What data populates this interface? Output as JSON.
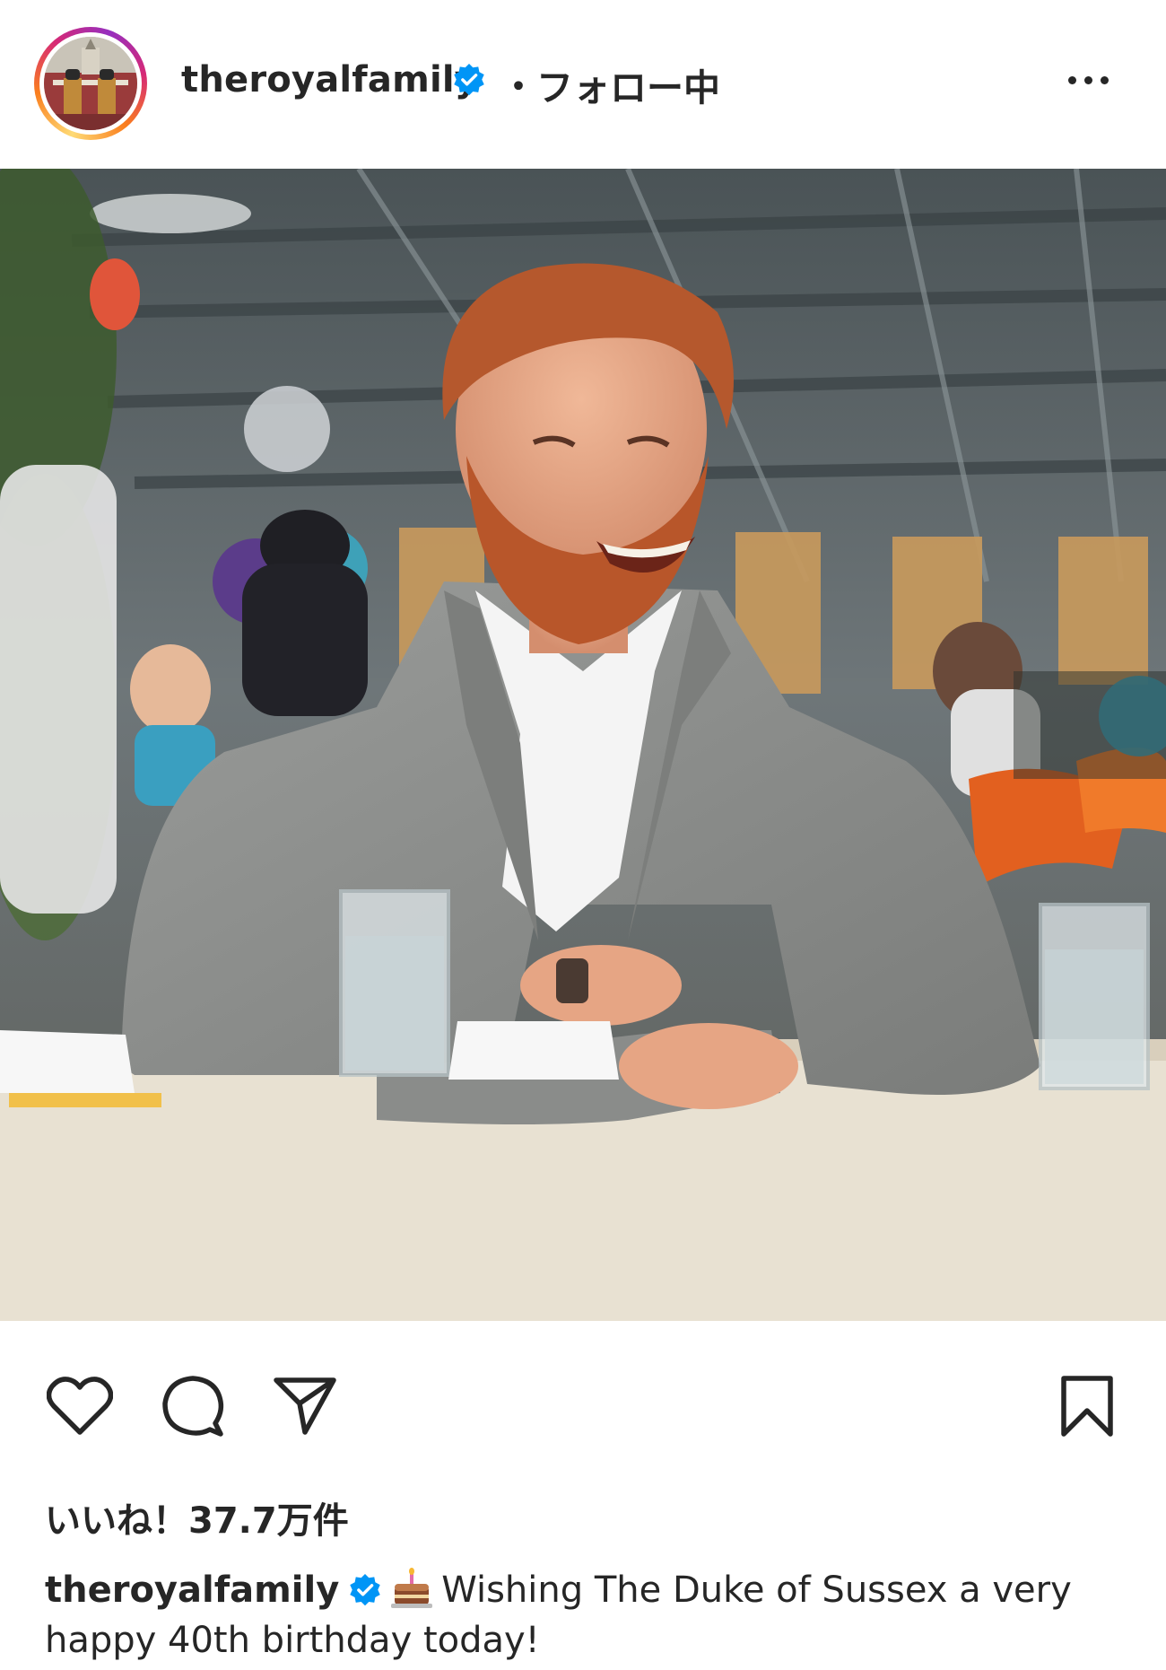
{
  "header": {
    "username": "theroyalfamily",
    "separator": "・",
    "follow_status": "フォロー中",
    "more_icon": "more-horizontal-icon"
  },
  "post": {
    "image_icon": "post-photo"
  },
  "actions": {
    "like_icon": "heart-icon",
    "comment_icon": "comment-icon",
    "share_icon": "send-icon",
    "save_icon": "bookmark-icon"
  },
  "likes": {
    "text": "いいね！37.7万件"
  },
  "caption": {
    "username": "theroyalfamily",
    "emoji": "birthday-cake-icon",
    "text": "Wishing The Duke of Sussex a very happy 40th birthday today!"
  },
  "colors": {
    "verified_blue": "#0095f6",
    "text": "#262626",
    "ring_start": "#feda75",
    "ring_mid": "#d62976",
    "ring_end": "#962fbf"
  }
}
